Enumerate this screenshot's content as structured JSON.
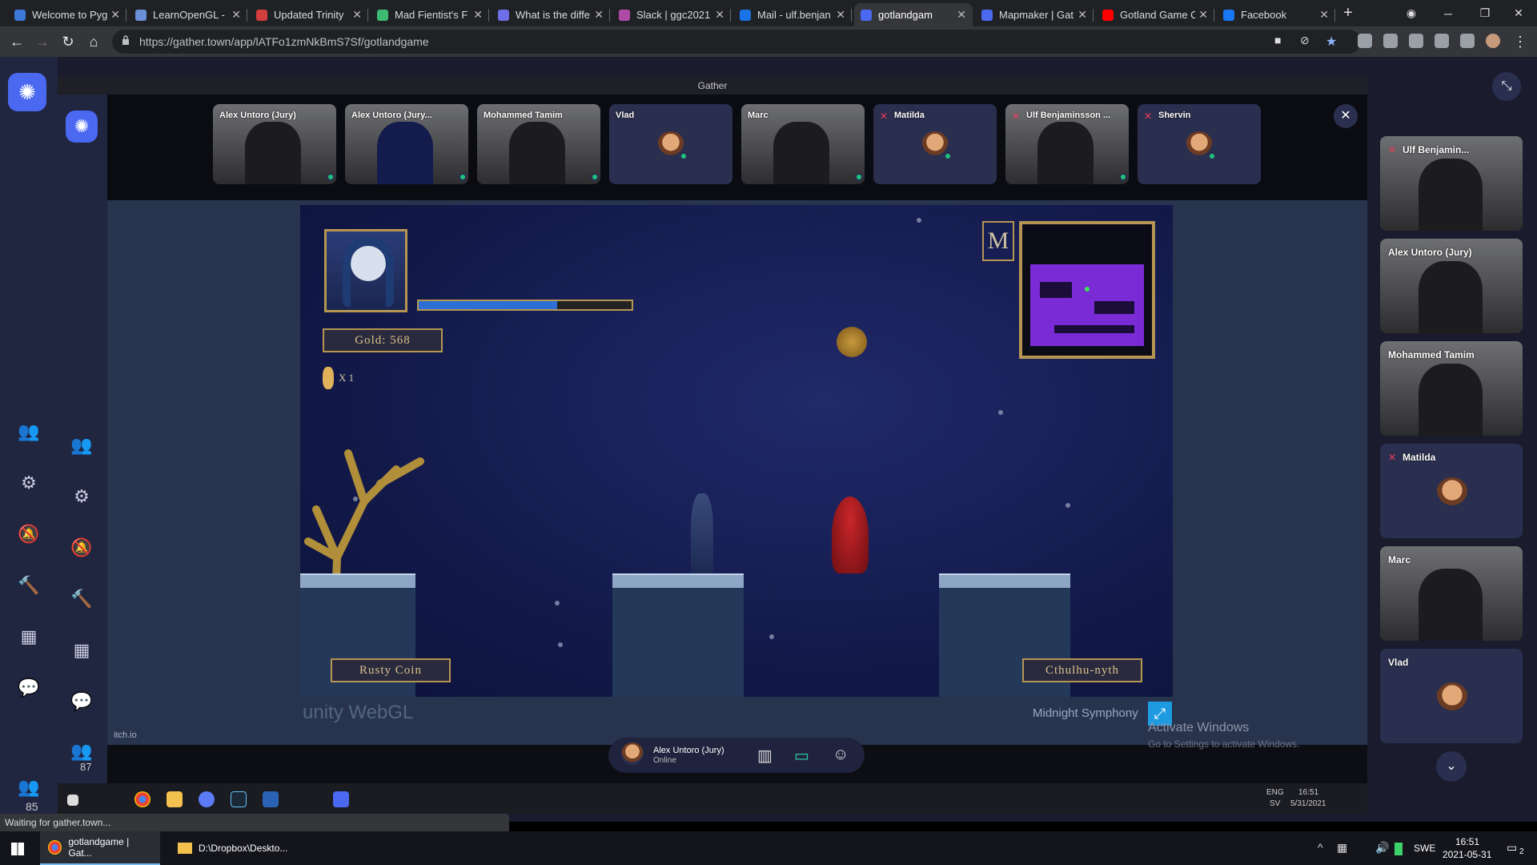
{
  "browser": {
    "tabs": [
      {
        "title": "Welcome to Pyg",
        "color": "#3b78d8"
      },
      {
        "title": "LearnOpenGL - ",
        "color": "#6b8fd6"
      },
      {
        "title": "Updated Trinity",
        "color": "#d23d3d"
      },
      {
        "title": "Mad Fientist's F",
        "color": "#3dbb72"
      },
      {
        "title": "What is the diffe",
        "color": "#6e6ee8"
      },
      {
        "title": "Slack | ggc2021",
        "color": "#b04aa9"
      },
      {
        "title": "Mail - ulf.benjan",
        "color": "#1a73e8"
      },
      {
        "title": "gotlandgam",
        "color": "#4a68f0",
        "active": true
      },
      {
        "title": "Mapmaker | Gat",
        "color": "#4a68f0"
      },
      {
        "title": "Gotland Game C",
        "color": "#ff0000"
      },
      {
        "title": "Facebook",
        "color": "#1877f2"
      }
    ],
    "new_tab": "+",
    "url": "https://gather.town/app/lATFo1zmNkBmS7Sf/gotlandgame",
    "status": "Waiting for gather.town..."
  },
  "gather": {
    "window_title": "Gather",
    "participants_stage": [
      {
        "name": "Alex Untoro (Jury)",
        "video": true
      },
      {
        "name": "Alex Untoro (Jury...",
        "video": true,
        "screen": true
      },
      {
        "name": "Mohammed Tamim",
        "video": true
      },
      {
        "name": "Vlad",
        "video": false
      },
      {
        "name": "Marc",
        "video": true
      },
      {
        "name": "Matilda",
        "video": false,
        "muted": true
      },
      {
        "name": "Ulf Benjaminsson ...",
        "video": true,
        "muted": true
      },
      {
        "name": "Shervin",
        "video": false,
        "muted": true
      }
    ],
    "side_participants": [
      {
        "name": "Ulf Benjamin...",
        "video": true,
        "muted": true
      },
      {
        "name": "Alex Untoro (Jury)",
        "video": true
      },
      {
        "name": "Mohammed Tamim",
        "video": true
      },
      {
        "name": "Matilda",
        "video": false,
        "muted": true
      },
      {
        "name": "Marc",
        "video": true
      },
      {
        "name": "Vlad",
        "video": false
      }
    ],
    "online_count_outer": "85",
    "online_count_inner": "87",
    "bottom_bar": {
      "name": "Alex Untoro (Jury)",
      "status": "Online"
    }
  },
  "game": {
    "gold_label": "Gold: 568",
    "key_count": "X 1",
    "health_level": 0.65,
    "minimap_letter": "M",
    "left_sign": "Rusty Coin",
    "right_sign": "Cthulhu-nyth",
    "engine": "unity WebGL",
    "track": "Midnight Symphony",
    "site": "itch.io",
    "activate_title": "Activate Windows",
    "activate_sub": "Go to Settings to activate Windows."
  },
  "inner_taskbar": {
    "lang1": "ENG",
    "lang2": "SV",
    "time": "16:51",
    "date": "5/31/2021"
  },
  "taskbar": {
    "items": [
      "gotlandgame | Gat...",
      "D:\\Dropbox\\Deskto..."
    ],
    "lang": "SWE",
    "time": "16:51",
    "date": "2021-05-31",
    "notif": "2"
  }
}
